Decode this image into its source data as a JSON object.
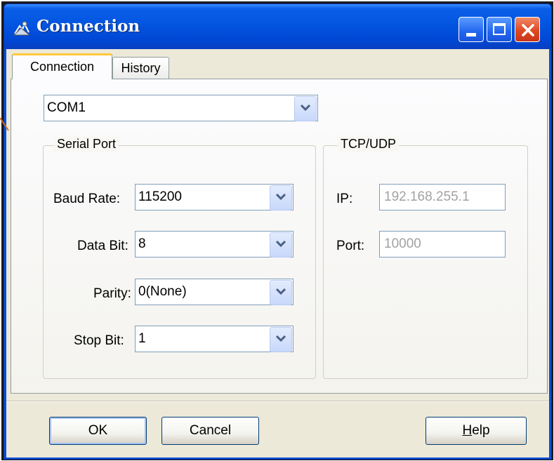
{
  "window": {
    "title": "Connection",
    "title_icon": "connection-icon"
  },
  "tabs": [
    {
      "label": "Connection",
      "active": true
    },
    {
      "label": "History",
      "active": false
    }
  ],
  "port_select": {
    "value": "COM1"
  },
  "serial_port": {
    "legend": "Serial Port",
    "baud_rate": {
      "label": "Baud Rate:",
      "value": "115200"
    },
    "data_bit": {
      "label": "Data Bit:",
      "value": "8"
    },
    "parity": {
      "label": "Parity:",
      "value": "0(None)"
    },
    "stop_bit": {
      "label": "Stop Bit:",
      "value": "1"
    }
  },
  "tcp_udp": {
    "legend": "TCP/UDP",
    "ip": {
      "label": "IP:",
      "value": "192.168.255.1"
    },
    "port": {
      "label": "Port:",
      "value": "10000"
    }
  },
  "buttons": {
    "ok": "OK",
    "cancel": "Cancel",
    "help_mnemonic": "H",
    "help_rest": "elp"
  },
  "colors": {
    "title_bar": "#0355e0",
    "close_button": "#dd4a22",
    "dialog_bg": "#ece9d8",
    "active_tab_accent": "#ffc83c",
    "disabled_text": "#a2a2a2"
  }
}
